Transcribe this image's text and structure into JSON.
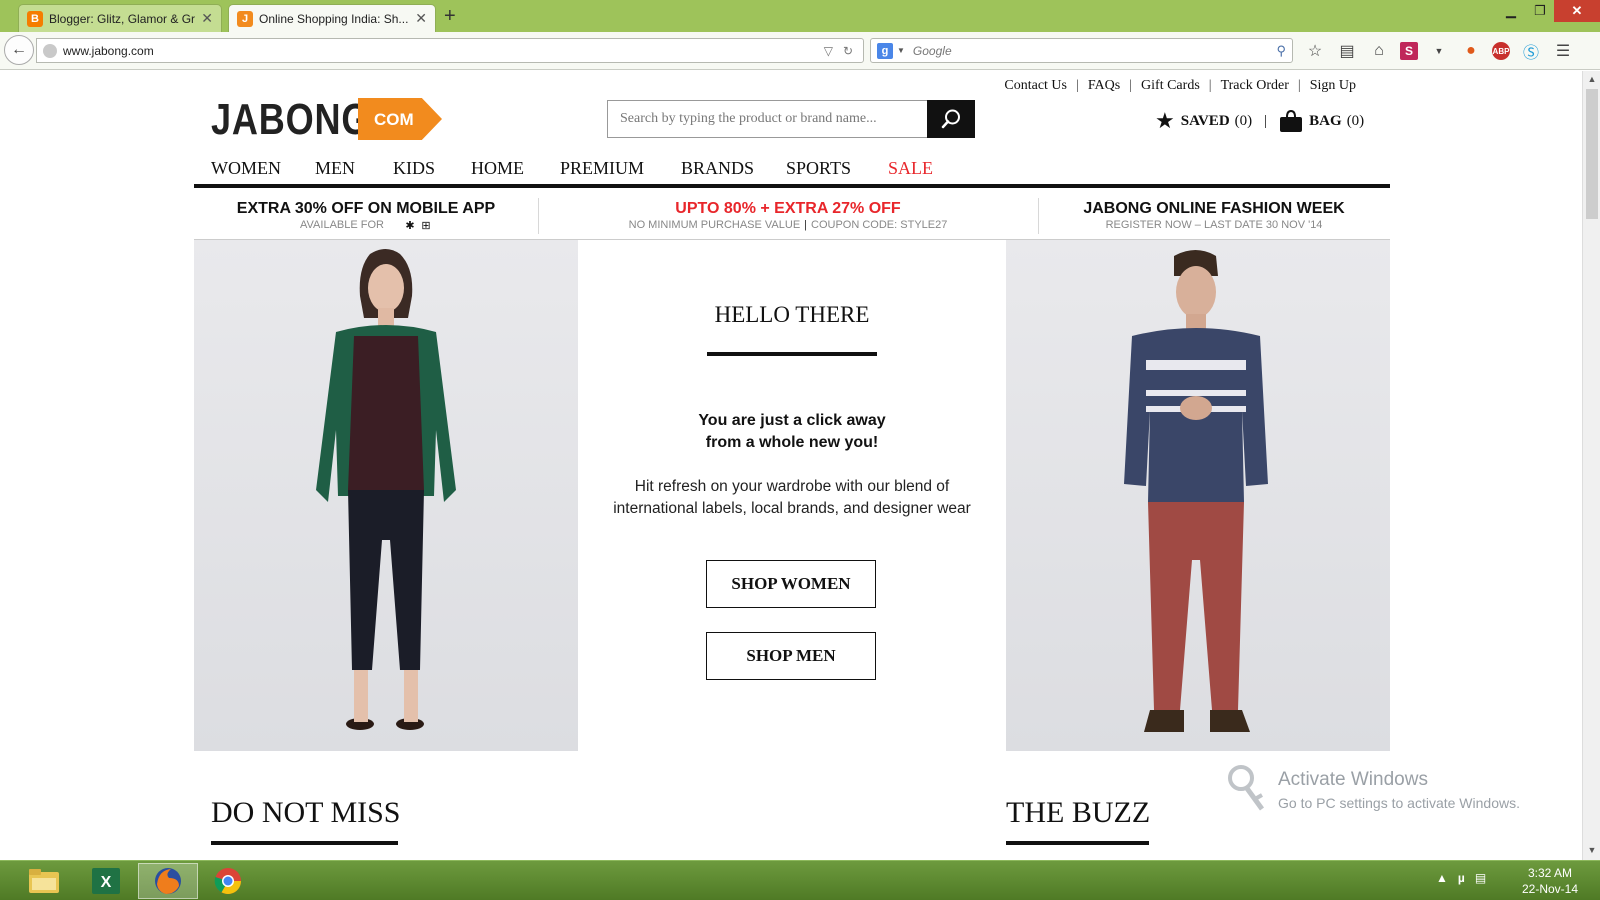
{
  "browser": {
    "tabs": [
      {
        "label": "Blogger: Glitz, Glamor & Gr...",
        "icon": "blogger-icon"
      },
      {
        "label": "Online Shopping India: Sh...",
        "icon": "jabong-icon"
      }
    ],
    "url": "www.jabong.com",
    "search_placeholder": "Google"
  },
  "header": {
    "toplinks": [
      "Contact Us",
      "FAQs",
      "Gift Cards",
      "Track Order",
      "Sign Up"
    ],
    "logo_word": "JABONG",
    "logo_tag": "COM",
    "search_placeholder": "Search by typing the product or brand name...",
    "saved_label": "SAVED",
    "saved_count": "(0)",
    "bag_label": "BAG",
    "bag_count": "(0)"
  },
  "nav": [
    "WOMEN",
    "MEN",
    "KIDS",
    "HOME",
    "PREMIUM",
    "BRANDS",
    "SPORTS",
    "SALE"
  ],
  "promos": [
    {
      "title": "EXTRA 30% OFF ON MOBILE APP",
      "sub": "AVAILABLE FOR"
    },
    {
      "title": "UPTO 80% + EXTRA 27% OFF",
      "sub_a": "NO MINIMUM PURCHASE VALUE",
      "sub_sep": "|",
      "sub_b": "COUPON CODE: STYLE27"
    },
    {
      "title": "JABONG ONLINE FASHION WEEK",
      "sub": "REGISTER NOW – LAST DATE 30 NOV '14"
    }
  ],
  "hero": {
    "title": "HELLO THERE",
    "tagline_1": "You are just a click away",
    "tagline_2": "from a whole new you!",
    "desc_1": "Hit refresh on your wardrobe with our blend of",
    "desc_2": "international labels, local brands, and designer wear",
    "shop_women": "SHOP WOMEN",
    "shop_men": "SHOP MEN"
  },
  "sections": {
    "left": "DO NOT MISS",
    "right": "THE BUZZ"
  },
  "watermark": {
    "line1": "Activate Windows",
    "line2": "Go to PC settings to activate Windows."
  },
  "taskbar": {
    "time": "3:32 AM",
    "date": "22-Nov-14"
  },
  "colors": {
    "accent_orange": "#f28b1e",
    "sale_red": "#e8262b",
    "tabbar_green": "#9ec35a"
  }
}
